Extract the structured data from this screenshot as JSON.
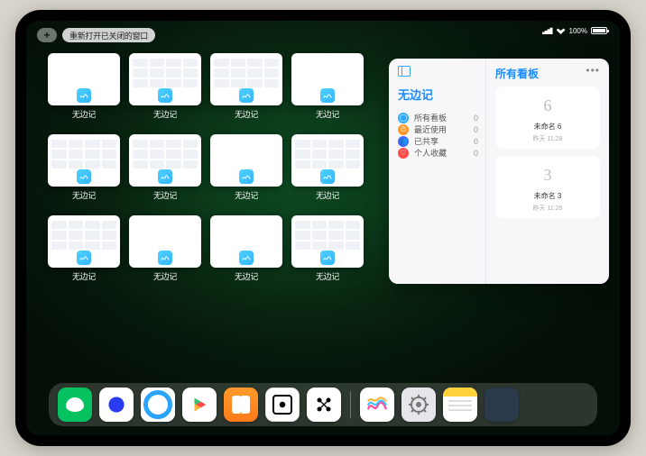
{
  "statusbar": {
    "battery_pct": "100%"
  },
  "top": {
    "plus": "+",
    "recent_closed": "重新打开已关闭的窗口"
  },
  "thumbs": [
    {
      "label": "无边记",
      "kind": "blank"
    },
    {
      "label": "无边记",
      "kind": "grid"
    },
    {
      "label": "无边记",
      "kind": "grid"
    },
    {
      "label": "无边记",
      "kind": "blank"
    },
    {
      "label": "无边记",
      "kind": "grid"
    },
    {
      "label": "无边记",
      "kind": "grid"
    },
    {
      "label": "无边记",
      "kind": "blank"
    },
    {
      "label": "无边记",
      "kind": "grid"
    },
    {
      "label": "无边记",
      "kind": "grid"
    },
    {
      "label": "无边记",
      "kind": "blank"
    },
    {
      "label": "无边记",
      "kind": "blank"
    },
    {
      "label": "无边记",
      "kind": "grid"
    }
  ],
  "detail": {
    "left_title": "无边记",
    "categories": [
      {
        "label": "所有看板",
        "count": "0",
        "color": "ic-blue",
        "glyph": "◯"
      },
      {
        "label": "最近使用",
        "count": "0",
        "color": "ic-orange",
        "glyph": "⏱"
      },
      {
        "label": "已共享",
        "count": "0",
        "color": "ic-indigo",
        "glyph": "👥"
      },
      {
        "label": "个人收藏",
        "count": "0",
        "color": "ic-red",
        "glyph": "♡"
      }
    ],
    "right_title": "所有看板",
    "ellipsis": "•••",
    "boards": [
      {
        "sketch": "6",
        "name": "未命名 6",
        "date": "昨天 11:28"
      },
      {
        "sketch": "3",
        "name": "未命名 3",
        "date": "昨天 11:25"
      }
    ]
  },
  "dock": {
    "apps": [
      {
        "name": "wechat-icon"
      },
      {
        "name": "quark-icon"
      },
      {
        "name": "qqbrowser-icon"
      },
      {
        "name": "play-icon"
      },
      {
        "name": "books-icon"
      },
      {
        "name": "dice-icon"
      },
      {
        "name": "nodes-icon"
      }
    ],
    "recent": [
      {
        "name": "freeform-icon"
      },
      {
        "name": "settings-icon"
      },
      {
        "name": "notes-icon"
      },
      {
        "name": "app-library-icon"
      }
    ]
  }
}
